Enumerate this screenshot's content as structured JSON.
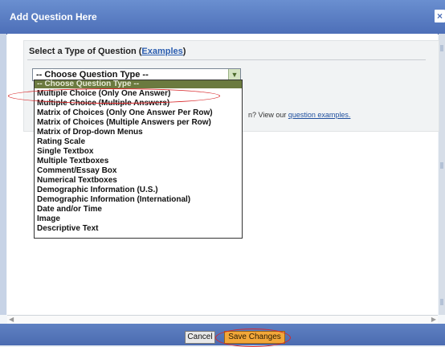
{
  "window": {
    "title": "Add Question Here",
    "close_icon": "×"
  },
  "section": {
    "label": "Select a Type of Question",
    "examples_link": "Examples"
  },
  "select": {
    "value": "-- Choose Question Type --",
    "arrow_icon": "chevron-down"
  },
  "options": [
    "-- Choose Question Type --",
    "Multiple Choice (Only One Answer)",
    "Multiple Choice (Multiple Answers)",
    "Matrix of Choices (Only One Answer Per Row)",
    "Matrix of Choices (Multiple Answers per Row)",
    "Matrix of Drop-down Menus",
    "Rating Scale",
    "Single Textbox",
    "Multiple Textboxes",
    "Comment/Essay Box",
    "Numerical Textboxes",
    "Demographic Information (U.S.)",
    "Demographic Information (International)",
    "Date and/or Time",
    "Image",
    "Descriptive Text"
  ],
  "hint": {
    "text": "n? View our",
    "link": "question examples."
  },
  "footer": {
    "cancel_label": "Cancel",
    "save_label": "Save Changes"
  },
  "colors": {
    "accent": "#d8272a",
    "titlebar": "#5a7cc4",
    "highlight": "#6b7a3f",
    "save": "#f2a73a"
  }
}
